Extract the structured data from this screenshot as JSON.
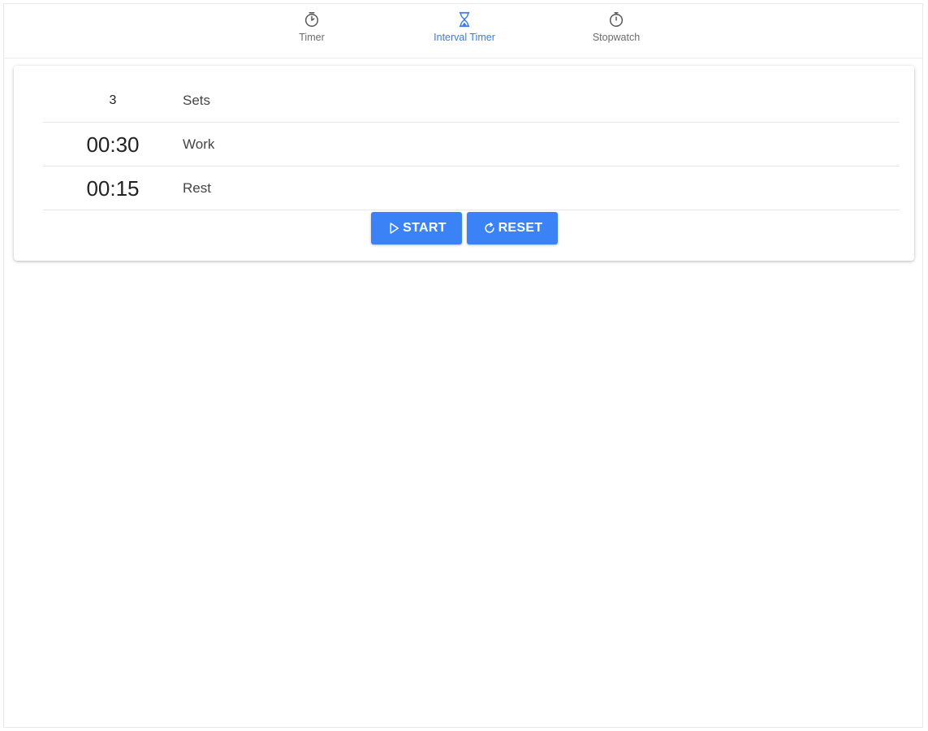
{
  "tabs": [
    {
      "label": "Timer",
      "icon": "timer-icon",
      "active": false
    },
    {
      "label": "Interval Timer",
      "icon": "hourglass-icon",
      "active": true
    },
    {
      "label": "Stopwatch",
      "icon": "stopwatch-icon",
      "active": false
    }
  ],
  "rows": {
    "sets": {
      "value": "3",
      "label": "Sets"
    },
    "work": {
      "value": "00:30",
      "label": "Work"
    },
    "rest": {
      "value": "00:15",
      "label": "Rest"
    }
  },
  "buttons": {
    "start_label": "START",
    "start_icon": "play-icon",
    "reset_label": "RESET",
    "reset_icon": "refresh-icon"
  },
  "colors": {
    "accent": "#3b82f6",
    "active_tab": "#3b7be0",
    "inactive_tab": "#6b6b6b"
  }
}
